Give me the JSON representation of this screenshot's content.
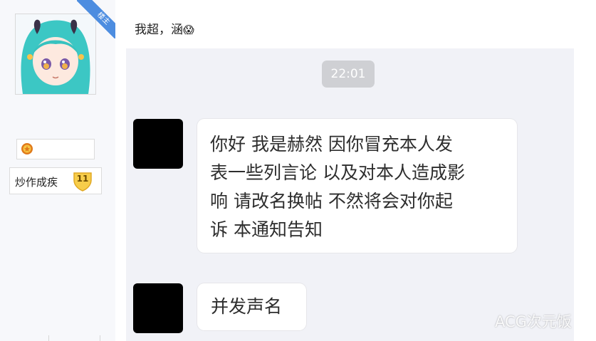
{
  "user": {
    "corner_badge": "楼主",
    "username": "炒作成疾",
    "level": "11"
  },
  "post": {
    "text": "我超，涵",
    "emoji": "😱"
  },
  "chat": {
    "time": "22:01",
    "messages": [
      {
        "lines": [
          "你好 我是赫然  因你冒充本人发",
          "表一些列言论 以及对本人造成影",
          "响 请改名换帖  不然将会对你起",
          "诉 本通知告知"
        ]
      },
      {
        "lines": [
          "并发声名"
        ]
      }
    ]
  },
  "watermark": "ACG次元饭"
}
